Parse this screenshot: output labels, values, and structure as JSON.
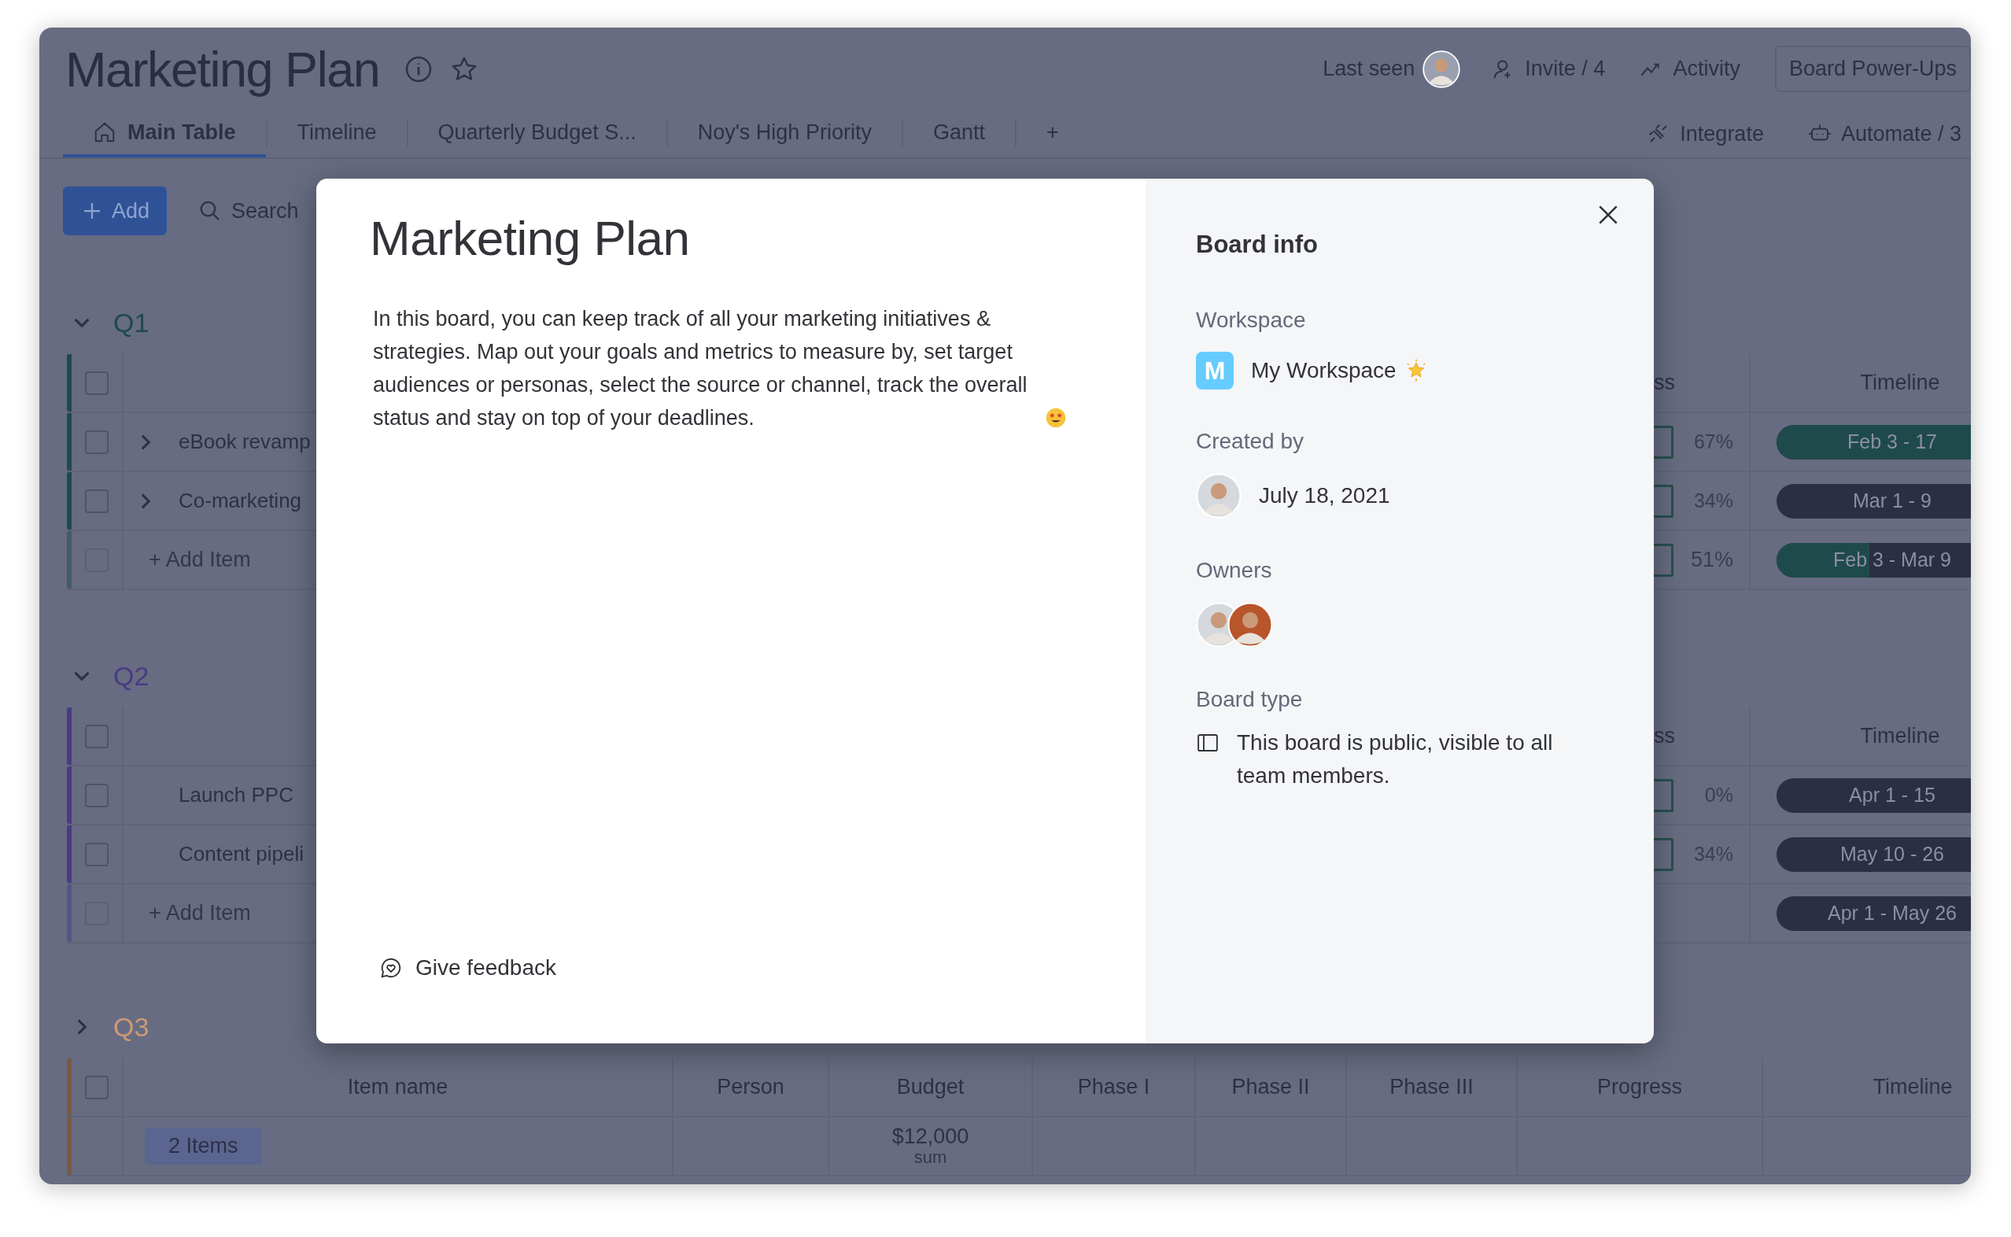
{
  "board": {
    "title": "Marketing Plan"
  },
  "header_actions": {
    "last_seen": "Last seen",
    "invite": "Invite / 4",
    "activity": "Activity",
    "power_ups": "Board Power-Ups"
  },
  "tabs": [
    {
      "label": "Main Table",
      "selected": true,
      "kind": "home"
    },
    {
      "label": "Timeline",
      "selected": false,
      "kind": "view"
    },
    {
      "label": "Quarterly Budget S...",
      "selected": false,
      "kind": "view"
    },
    {
      "label": "Noy's High Priority",
      "selected": false,
      "kind": "view"
    },
    {
      "label": "Gantt",
      "selected": false,
      "kind": "view"
    },
    {
      "label": "+",
      "selected": false,
      "kind": "add"
    }
  ],
  "view_actions": [
    {
      "label": "Integrate",
      "kind": "integrate"
    },
    {
      "label": "Automate / 3",
      "kind": "automate"
    }
  ],
  "toolbar": {
    "add": "Add",
    "search": "Search"
  },
  "groups": [
    {
      "title": "Q1",
      "color": "#1f4a4c",
      "expanded": true,
      "select_all": false,
      "progress_header": "ss",
      "timeline_header": "Timeline",
      "items": [
        {
          "name": "eBook revamp",
          "checked": false,
          "expandable": true,
          "progress": "67%",
          "timeline": "Feb 3 - 17",
          "level": 1
        },
        {
          "name": "Co-marketing",
          "checked": false,
          "expandable": true,
          "progress": "34%",
          "timeline": "Mar 1 - 9"
        }
      ],
      "add_item": "+ Add Item",
      "add_checked": false,
      "summary": {
        "progress": "51%",
        "timeline": "Feb 3 - Mar 9",
        "level": 0.4
      }
    },
    {
      "title": "Q2",
      "color": "#4b3a82",
      "expanded": true,
      "select_all": false,
      "progress_header": "ss",
      "timeline_header": "Timeline",
      "items": [
        {
          "name": "Launch PPC",
          "checked": false,
          "expandable": false,
          "progress": "0%",
          "timeline": "Apr 1 - 15"
        },
        {
          "name": "Content pipeli",
          "checked": false,
          "expandable": false,
          "progress": "34%",
          "timeline": "May 10 - 26"
        }
      ],
      "add_item": "+ Add Item",
      "add_checked": false,
      "summary": {
        "timeline": "Apr 1 - May 26"
      }
    },
    {
      "title": "Q3",
      "color": "#7a5a44",
      "expanded": false,
      "select_all": false,
      "columns": [
        "Item name",
        "Person",
        "Budget",
        "Phase I",
        "Phase II",
        "Phase III",
        "Progress",
        "Timeline"
      ],
      "summary": {
        "count": "2 Items",
        "budget": "$12,000",
        "budget_note": "sum"
      }
    }
  ],
  "modal": {
    "title": "Marketing Plan",
    "description": "In this board, you can keep track of all your marketing initiatives & strategies. Map out your goals and metrics to measure by, set target audiences or personas, select the source or channel, track the overall status and stay on top of your deadlines.",
    "feedback": "Give feedback",
    "info_title": "Board info",
    "workspace_label": "Workspace",
    "workspace_initial": "M",
    "workspace_name": "My Workspace",
    "created_label": "Created by",
    "created_date": "July 18, 2021",
    "owners_label": "Owners",
    "board_type_label": "Board type",
    "board_type": "This board is public, visible to all team members."
  }
}
